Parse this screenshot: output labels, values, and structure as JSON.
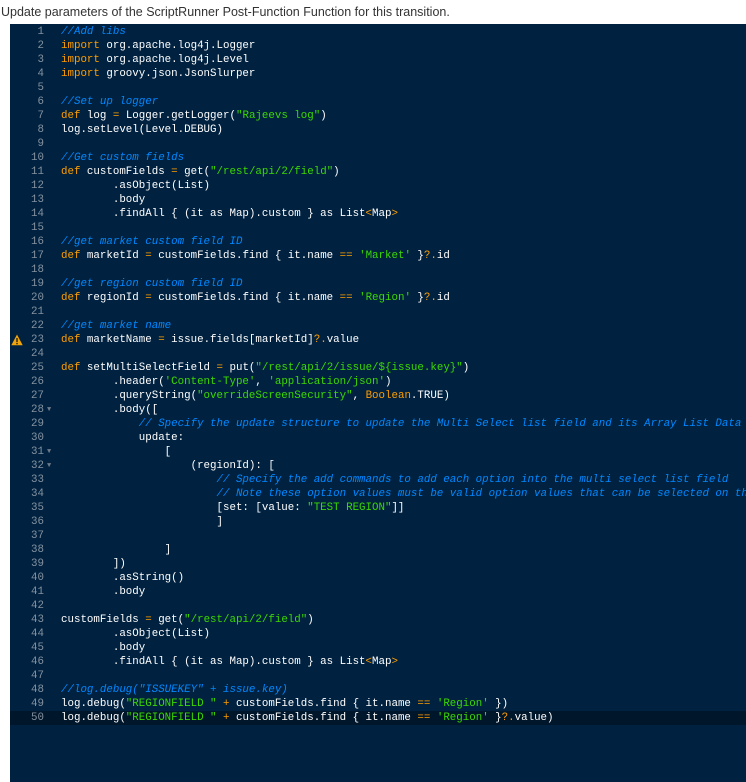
{
  "title": "Update parameters of the ScriptRunner Post-Function Function for this transition.",
  "colors": {
    "background": "#002240",
    "keyword": "#ff9d00",
    "string": "#3ad900",
    "comment": "#0088ff",
    "text": "#ffffff",
    "active_line": "#00162b"
  },
  "active_line": 50,
  "warning_line": 23,
  "fold_lines": [
    28,
    31,
    32
  ],
  "code_lines": [
    [
      [
        "c",
        "//Add libs"
      ]
    ],
    [
      [
        "k",
        "import"
      ],
      [
        "t",
        " org.apache.log4j.Logger"
      ]
    ],
    [
      [
        "k",
        "import"
      ],
      [
        "t",
        " org.apache.log4j.Level"
      ]
    ],
    [
      [
        "k",
        "import"
      ],
      [
        "t",
        " groovy.json.JsonSlurper"
      ]
    ],
    [],
    [
      [
        "c",
        "//Set up logger"
      ]
    ],
    [
      [
        "k",
        "def"
      ],
      [
        "t",
        " log "
      ],
      [
        "o",
        "="
      ],
      [
        "t",
        " Logger.getLogger("
      ],
      [
        "s",
        "\"Rajeevs log\""
      ],
      [
        "t",
        ")"
      ]
    ],
    [
      [
        "t",
        "log.setLevel(Level.DEBUG)"
      ]
    ],
    [],
    [
      [
        "c",
        "//Get custom fields"
      ]
    ],
    [
      [
        "k",
        "def"
      ],
      [
        "t",
        " customFields "
      ],
      [
        "o",
        "="
      ],
      [
        "t",
        " get("
      ],
      [
        "s",
        "\"/rest/api/2/field\""
      ],
      [
        "t",
        ")"
      ]
    ],
    [
      [
        "t",
        "        .asObject(List)"
      ]
    ],
    [
      [
        "t",
        "        .body"
      ]
    ],
    [
      [
        "t",
        "        .findAll { (it as Map).custom } as List"
      ],
      [
        "o",
        "<"
      ],
      [
        "t",
        "Map"
      ],
      [
        "o",
        ">"
      ]
    ],
    [],
    [
      [
        "c",
        "//get market custom field ID"
      ]
    ],
    [
      [
        "k",
        "def"
      ],
      [
        "t",
        " marketId "
      ],
      [
        "o",
        "="
      ],
      [
        "t",
        " customFields.find { it.name "
      ],
      [
        "o",
        "=="
      ],
      [
        "t",
        " "
      ],
      [
        "s",
        "'Market'"
      ],
      [
        "t",
        " }"
      ],
      [
        "o",
        "?."
      ],
      [
        "t",
        "id"
      ]
    ],
    [],
    [
      [
        "c",
        "//get region custom field ID"
      ]
    ],
    [
      [
        "k",
        "def"
      ],
      [
        "t",
        " regionId "
      ],
      [
        "o",
        "="
      ],
      [
        "t",
        " customFields.find { it.name "
      ],
      [
        "o",
        "=="
      ],
      [
        "t",
        " "
      ],
      [
        "s",
        "'Region'"
      ],
      [
        "t",
        " }"
      ],
      [
        "o",
        "?."
      ],
      [
        "t",
        "id"
      ]
    ],
    [],
    [
      [
        "c",
        "//get market name"
      ]
    ],
    [
      [
        "k",
        "def"
      ],
      [
        "t",
        " marketName "
      ],
      [
        "o",
        "="
      ],
      [
        "t",
        " issue.fields[marketId]"
      ],
      [
        "o",
        "?."
      ],
      [
        "t",
        "value"
      ]
    ],
    [],
    [
      [
        "k",
        "def"
      ],
      [
        "t",
        " setMultiSelectField "
      ],
      [
        "o",
        "="
      ],
      [
        "t",
        " put("
      ],
      [
        "s",
        "\"/rest/api/2/issue/${issue.key}\""
      ],
      [
        "t",
        ")"
      ]
    ],
    [
      [
        "t",
        "        .header("
      ],
      [
        "s",
        "'Content-Type'"
      ],
      [
        "t",
        ", "
      ],
      [
        "s",
        "'application/json'"
      ],
      [
        "t",
        ")"
      ]
    ],
    [
      [
        "t",
        "        .queryString("
      ],
      [
        "s",
        "\"overrideScreenSecurity\""
      ],
      [
        "t",
        ", "
      ],
      [
        "k",
        "Boolean"
      ],
      [
        "t",
        ".TRUE)"
      ]
    ],
    [
      [
        "t",
        "        .body(["
      ]
    ],
    [
      [
        "t",
        "            "
      ],
      [
        "c",
        "// Specify the update structure to update the Multi Select list field and its Array List Data"
      ]
    ],
    [
      [
        "t",
        "            update:"
      ]
    ],
    [
      [
        "t",
        "                ["
      ]
    ],
    [
      [
        "t",
        "                    (regionId): ["
      ]
    ],
    [
      [
        "t",
        "                        "
      ],
      [
        "c",
        "// Specify the add commands to add each option into the multi select list field"
      ]
    ],
    [
      [
        "t",
        "                        "
      ],
      [
        "c",
        "// Note these option values must be valid option values that can be selected on the field"
      ]
    ],
    [
      [
        "t",
        "                        [set: [value: "
      ],
      [
        "s",
        "\"TEST REGION\""
      ],
      [
        "t",
        "]]"
      ]
    ],
    [
      [
        "t",
        "                        ]"
      ]
    ],
    [],
    [
      [
        "t",
        "                ]"
      ]
    ],
    [
      [
        "t",
        "        ])"
      ]
    ],
    [
      [
        "t",
        "        .asString()"
      ]
    ],
    [
      [
        "t",
        "        .body"
      ]
    ],
    [],
    [
      [
        "t",
        "customFields "
      ],
      [
        "o",
        "="
      ],
      [
        "t",
        " get("
      ],
      [
        "s",
        "\"/rest/api/2/field\""
      ],
      [
        "t",
        ")"
      ]
    ],
    [
      [
        "t",
        "        .asObject(List)"
      ]
    ],
    [
      [
        "t",
        "        .body"
      ]
    ],
    [
      [
        "t",
        "        .findAll { (it as Map).custom } as List"
      ],
      [
        "o",
        "<"
      ],
      [
        "t",
        "Map"
      ],
      [
        "o",
        ">"
      ]
    ],
    [],
    [
      [
        "c",
        "//log.debug(\"ISSUEKEY\" + issue.key)"
      ]
    ],
    [
      [
        "t",
        "log.debug("
      ],
      [
        "s",
        "\"REGIONFIELD \""
      ],
      [
        "t",
        " "
      ],
      [
        "o",
        "+"
      ],
      [
        "t",
        " customFields.find { it.name "
      ],
      [
        "o",
        "=="
      ],
      [
        "t",
        " "
      ],
      [
        "s",
        "'Region'"
      ],
      [
        "t",
        " })"
      ]
    ],
    [
      [
        "t",
        "log.debug("
      ],
      [
        "s",
        "\"REGIONFIELD \""
      ],
      [
        "t",
        " "
      ],
      [
        "o",
        "+"
      ],
      [
        "t",
        " customFields.find { it.name "
      ],
      [
        "o",
        "=="
      ],
      [
        "t",
        " "
      ],
      [
        "s",
        "'Region'"
      ],
      [
        "t",
        " }"
      ],
      [
        "o",
        "?."
      ],
      [
        "t",
        "value)"
      ]
    ]
  ]
}
